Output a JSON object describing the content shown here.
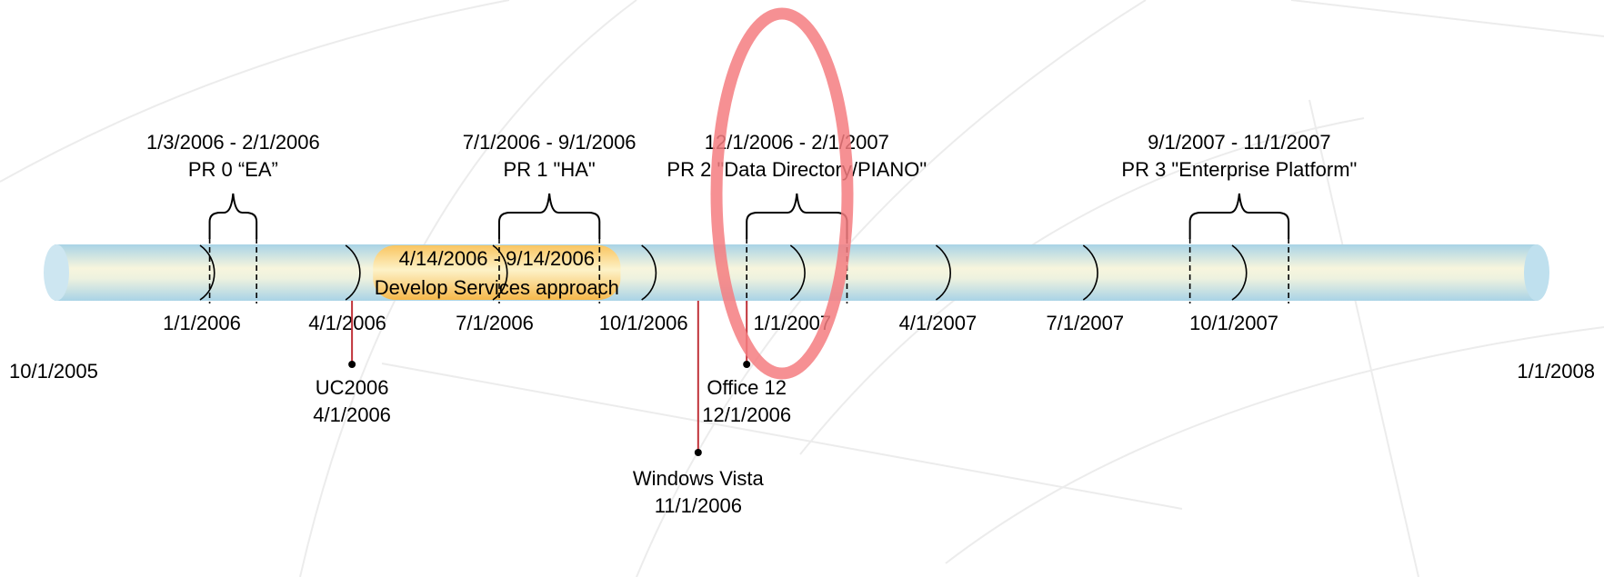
{
  "range": {
    "start": "10/1/2005",
    "end": "1/1/2008"
  },
  "start_label": "10/1/2005",
  "end_label": "1/1/2008",
  "ticks": [
    {
      "date": "1/1/2006",
      "label": "1/1/2006"
    },
    {
      "date": "4/1/2006",
      "label": "4/1/2006"
    },
    {
      "date": "7/1/2006",
      "label": "7/1/2006"
    },
    {
      "date": "10/1/2006",
      "label": "10/1/2006"
    },
    {
      "date": "1/1/2007",
      "label": "1/1/2007"
    },
    {
      "date": "4/1/2007",
      "label": "4/1/2007"
    },
    {
      "date": "7/1/2007",
      "label": "7/1/2007"
    },
    {
      "date": "10/1/2007",
      "label": "10/1/2007"
    }
  ],
  "spans": [
    {
      "start": "1/3/2006",
      "end": "2/1/2006",
      "dates": "1/3/2006 - 2/1/2006",
      "name": "PR 0 “EA”"
    },
    {
      "start": "7/1/2006",
      "end": "9/1/2006",
      "dates": "7/1/2006 - 9/1/2006",
      "name": "PR 1 \"HA\""
    },
    {
      "start": "12/1/2006",
      "end": "2/1/2007",
      "dates": "12/1/2006 - 2/1/2007",
      "name": "PR 2 \"Data Directory/PIANO\""
    },
    {
      "start": "9/1/2007",
      "end": "11/1/2007",
      "dates": "9/1/2007 - 11/1/2007",
      "name": "PR 3 \"Enterprise Platform\""
    }
  ],
  "phase": {
    "start": "4/14/2006",
    "end": "9/14/2006",
    "dates": "4/14/2006 - 9/14/2006",
    "label": "Develop Services approach"
  },
  "milestones": [
    {
      "date": "4/1/2006",
      "name": "UC2006",
      "date_label": "4/1/2006"
    },
    {
      "date": "11/1/2006",
      "name": "Windows Vista",
      "date_label": "11/1/2006"
    },
    {
      "date": "12/1/2006",
      "name": "Office 12",
      "date_label": "12/1/2006"
    }
  ],
  "highlight": {
    "target": "PR 2",
    "color": "#f47c80"
  },
  "colors": {
    "bar_light": "#f6f4dc",
    "bar_blue": "#b9dcea",
    "bar_edge": "#9ccbe0",
    "phase_light": "#fdf1c2",
    "phase_dark": "#f7bf52",
    "milestone": "#c0333a"
  }
}
